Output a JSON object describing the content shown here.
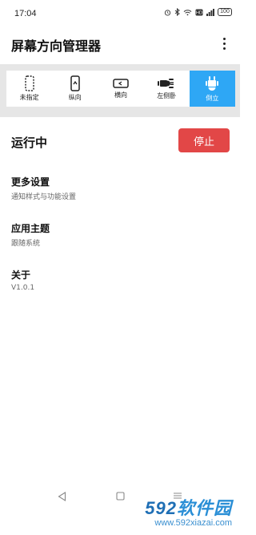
{
  "status_bar": {
    "time": "17:04",
    "battery": "100",
    "icons": [
      "alarm-icon",
      "bluetooth-icon",
      "wifi-icon",
      "hd-icon",
      "signal-icon",
      "battery-icon"
    ]
  },
  "app_bar": {
    "title": "屏幕方向管理器",
    "menu_icon": "more-vert-icon"
  },
  "modes": [
    {
      "label": "未指定",
      "icon": "phone-dashed-icon",
      "active": false
    },
    {
      "label": "纵向",
      "icon": "phone-portrait-icon",
      "active": false
    },
    {
      "label": "横向",
      "icon": "phone-landscape-icon",
      "active": false
    },
    {
      "label": "左侧卧",
      "icon": "robot-lying-icon",
      "active": false
    },
    {
      "label": "倒立",
      "icon": "robot-upside-down-icon",
      "active": true
    }
  ],
  "run": {
    "status": "运行中",
    "stop_label": "停止"
  },
  "settings": {
    "more": {
      "title": "更多设置",
      "subtitle": "通知样式与功能设置"
    },
    "theme": {
      "title": "应用主题",
      "subtitle": "跟随系统"
    },
    "about": {
      "title": "关于",
      "subtitle": "V1.0.1"
    }
  },
  "watermark": {
    "logo_number": "592",
    "logo_text": "软件园",
    "url": "www.592xiazai.com"
  },
  "colors": {
    "accent": "#2ea7f5",
    "stop": "#e24747",
    "strip_bg": "#e6e6e6"
  }
}
